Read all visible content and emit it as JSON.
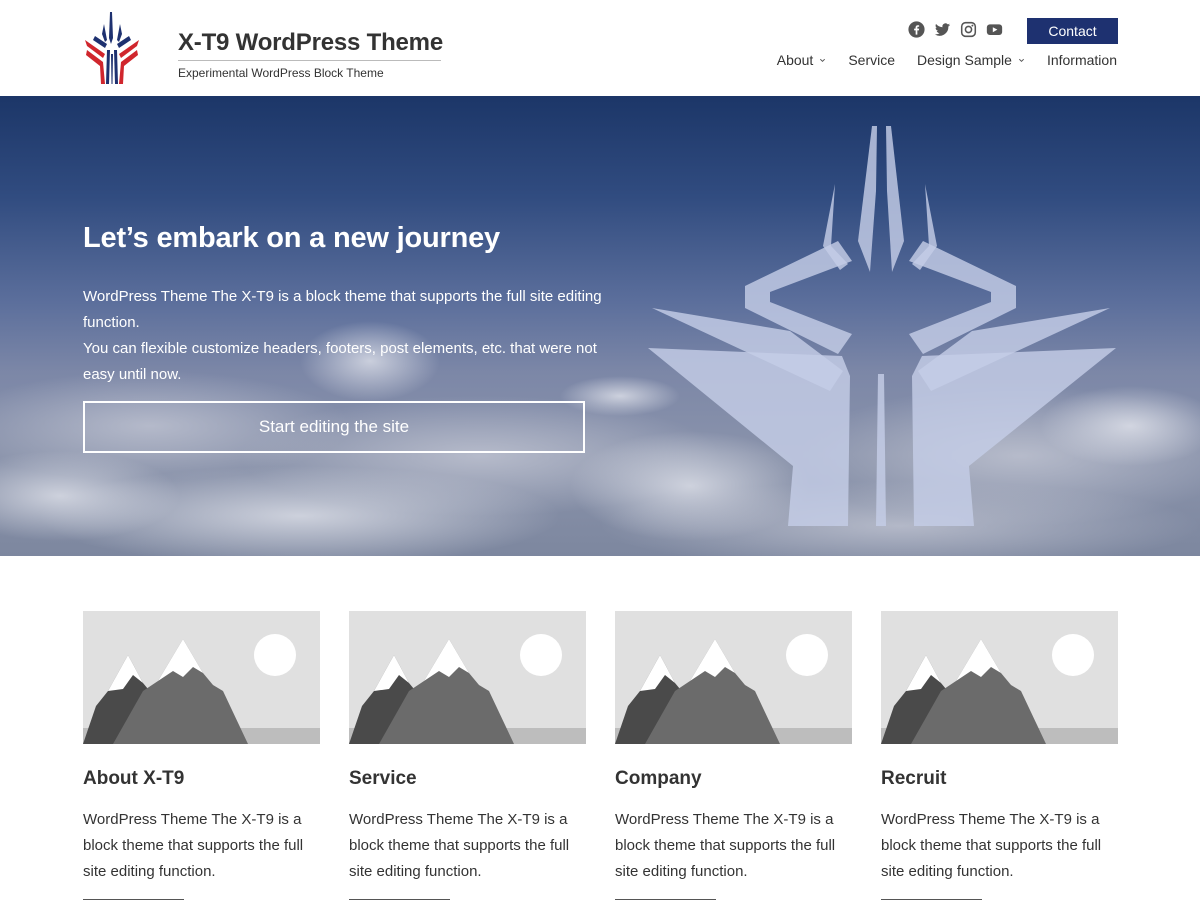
{
  "header": {
    "site_title": "X-T9 WordPress Theme",
    "tagline": "Experimental WordPress Block Theme",
    "contact_label": "Contact",
    "social_icons": [
      "facebook-icon",
      "twitter-icon",
      "instagram-icon",
      "youtube-icon"
    ],
    "nav": [
      {
        "label": "About",
        "has_submenu": true
      },
      {
        "label": "Service",
        "has_submenu": false
      },
      {
        "label": "Design Sample",
        "has_submenu": true
      },
      {
        "label": "Information",
        "has_submenu": false
      }
    ]
  },
  "hero": {
    "title": "Let’s embark on a new journey",
    "text_line1": "WordPress Theme The X-T9 is a block theme that supports the full site editing function.",
    "text_line2": "You can flexible customize headers, footers, post elements, etc. that were not easy until now.",
    "button_label": "Start editing the site"
  },
  "cards": [
    {
      "title": "About X-T9",
      "text": "WordPress Theme The X-T9 is a block theme that supports the full site editing function."
    },
    {
      "title": "Service",
      "text": "WordPress Theme The X-T9 is a block theme that supports the full site editing function."
    },
    {
      "title": "Company",
      "text": "WordPress Theme The X-T9 is a block theme that supports the full site editing function."
    },
    {
      "title": "Recruit",
      "text": "WordPress Theme The X-T9 is a block theme that supports the full site editing function."
    }
  ],
  "colors": {
    "brand_navy": "#1e3170",
    "logo_red": "#d0262d",
    "logo_blue": "#1e3170",
    "text": "#333333",
    "placeholder_bg": "#e0e0e0"
  }
}
